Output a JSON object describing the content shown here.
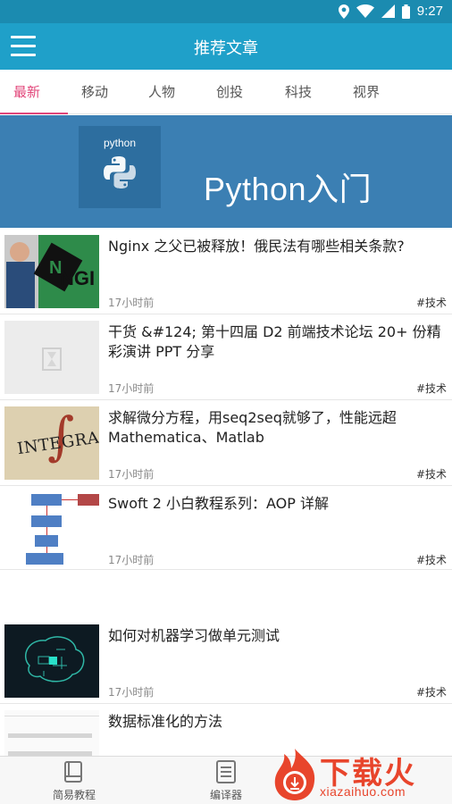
{
  "status_bar": {
    "time": "9:27",
    "icons": [
      "location-icon",
      "wifi-icon",
      "signal-icon",
      "battery-icon"
    ]
  },
  "app_bar": {
    "title": "推荐文章",
    "menu_icon": "hamburger-menu-icon"
  },
  "tabs": [
    {
      "label": "最新",
      "active": true
    },
    {
      "label": "移动",
      "active": false
    },
    {
      "label": "人物",
      "active": false
    },
    {
      "label": "创投",
      "active": false
    },
    {
      "label": "科技",
      "active": false
    },
    {
      "label": "视界",
      "active": false
    }
  ],
  "banner": {
    "logo_text": "python",
    "title": "Python入门"
  },
  "articles": [
    {
      "title": "Nginx 之父已被释放！俄民法有哪些相关条款?",
      "time": "17小时前",
      "tag": "#技术",
      "thumb": "nginx-photo"
    },
    {
      "title": "干货 &#124; 第十四届 D2 前端技术论坛 20+ 份精彩演讲 PPT 分享",
      "time": "17小时前",
      "tag": "#技术",
      "thumb": "placeholder-hourglass"
    },
    {
      "title": "求解微分方程，用seq2seq就够了，性能远超 Mathematica、Matlab",
      "time": "17小时前",
      "tag": "#技术",
      "thumb": "integral-image"
    },
    {
      "title": "Swoft 2 小白教程系列：AOP 详解",
      "time": "17小时前",
      "tag": "#技术",
      "thumb": "aop-diagram"
    },
    {
      "title": "如何对机器学习做单元测试",
      "time": "17小时前",
      "tag": "#技术",
      "thumb": "ml-brain-image"
    },
    {
      "title": "数据标准化的方法",
      "time": "",
      "tag": "",
      "thumb": "code-screenshot"
    }
  ],
  "bottom_nav": [
    {
      "label": "简易教程",
      "icon": "book-icon"
    },
    {
      "label": "编译器",
      "icon": "document-icon"
    }
  ],
  "watermark": {
    "main": "下载火",
    "sub": "xiazaihuo.com"
  },
  "colors": {
    "status_bar": "#1b8bb0",
    "app_bar": "#1fa0c9",
    "accent_tab": "#e2467a",
    "banner": "#3b7fb3",
    "watermark": "#e8452c"
  }
}
